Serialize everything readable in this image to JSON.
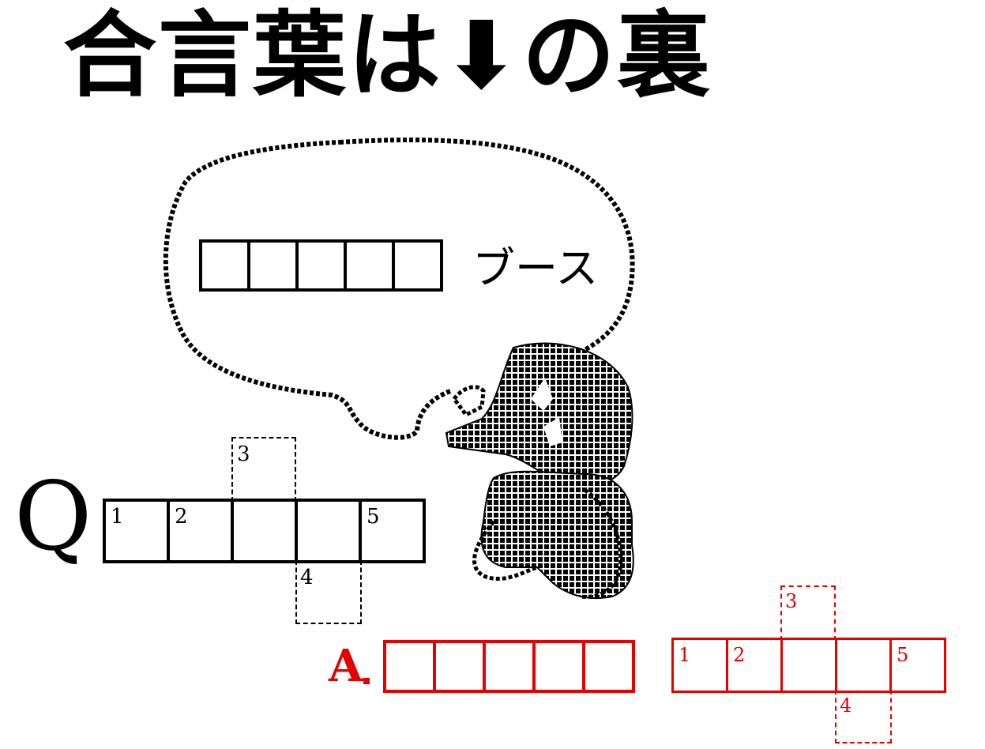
{
  "title": "合言葉は⬇の裏",
  "speech": {
    "suffix": "ブース",
    "blank_count": 5
  },
  "question": {
    "label": "Q",
    "cells": [
      "1",
      "2",
      "",
      "",
      "5"
    ],
    "flap_top": "3",
    "flap_bottom": "4"
  },
  "answer": {
    "label": "A",
    "blank_count": 5,
    "cells": [
      "1",
      "2",
      "",
      "",
      "5"
    ],
    "flap_top": "3",
    "flap_bottom": "4"
  },
  "colors": {
    "ink": "#000000",
    "answer": "#e60000",
    "background": "#ffffff"
  }
}
